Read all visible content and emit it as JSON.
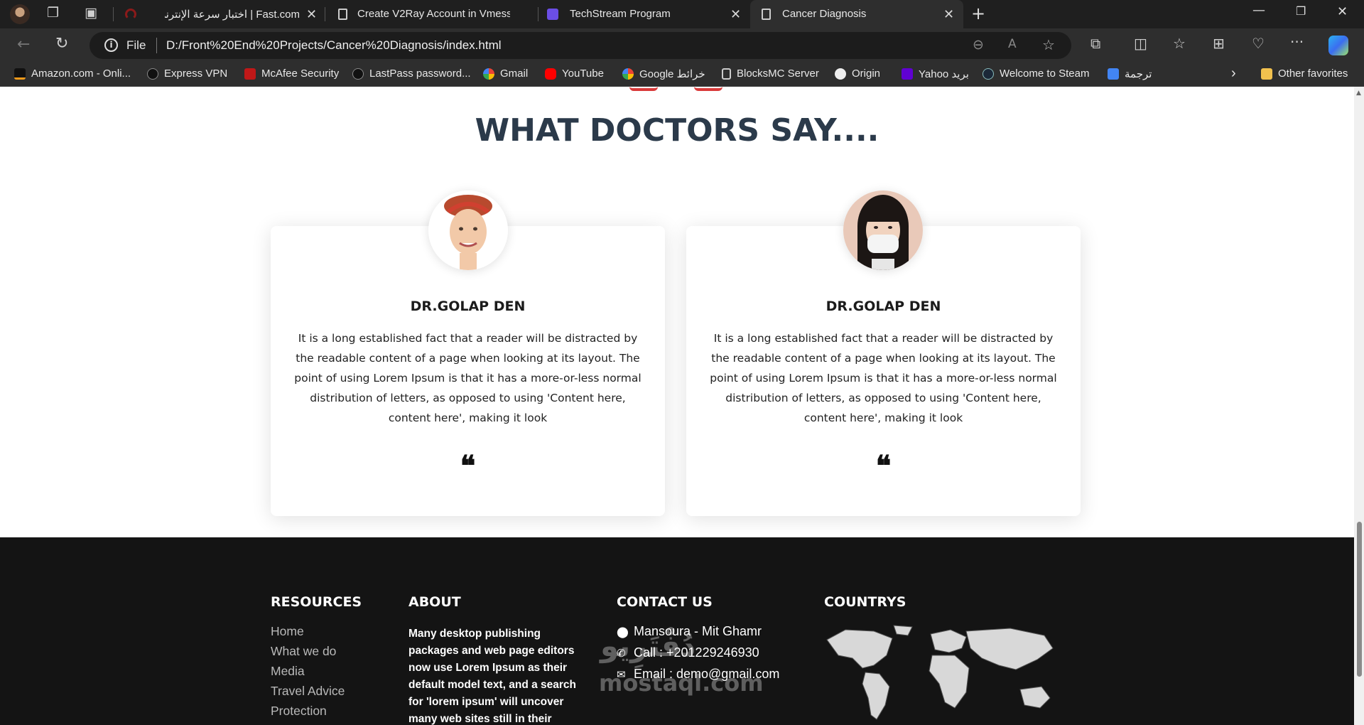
{
  "browser": {
    "tabs": [
      {
        "label": "Fast.com | اختبار سرعة الإنترنت",
        "favicon": "speedometer-icon",
        "active": false
      },
      {
        "label": "Create V2Ray Account in Vmess",
        "favicon": "page-icon",
        "active": false
      },
      {
        "label": "TechStream Program",
        "favicon": "list-icon",
        "active": false
      },
      {
        "label": "Cancer Diagnosis",
        "favicon": "page-icon",
        "active": true
      }
    ],
    "address": {
      "scheme_label": "File",
      "url": "D:/Front%20End%20Projects/Cancer%20Diagnosis/index.html"
    },
    "bookmarks": [
      {
        "label": "Amazon.com - Onli...",
        "icon": "amazon-icon"
      },
      {
        "label": "Express VPN",
        "icon": "hp-icon"
      },
      {
        "label": "McAfee Security",
        "icon": "mcafee-icon"
      },
      {
        "label": "LastPass password...",
        "icon": "hp-icon"
      },
      {
        "label": "Gmail",
        "icon": "google-icon"
      },
      {
        "label": "YouTube",
        "icon": "youtube-icon"
      },
      {
        "label": "Google خرائط",
        "icon": "google-icon"
      },
      {
        "label": "BlocksMC Server",
        "icon": "page-icon"
      },
      {
        "label": "Origin",
        "icon": "ea-icon"
      },
      {
        "label": "Yahoo بريد",
        "icon": "yahoo-icon"
      },
      {
        "label": "Welcome to Steam",
        "icon": "steam-icon"
      },
      {
        "label": "ترجمة",
        "icon": "translate-icon"
      }
    ],
    "other_favorites": "Other favorites"
  },
  "page": {
    "heading": "WHAT DOCTORS SAY....",
    "doctors": [
      {
        "name": "DR.GOLAP DEN",
        "text": "It is a long established fact that a reader will be distracted by the readable content of a page when looking at its layout. The point of using Lorem Ipsum is that it has a more-or-less normal distribution of letters, as opposed to using 'Content here, content here', making it look",
        "quote_glyph": "❝"
      },
      {
        "name": "DR.GOLAP DEN",
        "text": "It is a long established fact that a reader will be distracted by the readable content of a page when looking at its layout. The point of using Lorem Ipsum is that it has a more-or-less normal distribution of letters, as opposed to using 'Content here, content here', making it look",
        "quote_glyph": "❝"
      }
    ],
    "footer": {
      "resources": {
        "title": "RESOURCES",
        "links": [
          "Home",
          "What we do",
          "Media",
          "Travel Advice",
          "Protection"
        ]
      },
      "about": {
        "title": "ABOUT",
        "text": "Many desktop publishing packages and web page editors now use Lorem Ipsum as their default model text, and a search for 'lorem ipsum' will uncover many web sites still in their"
      },
      "contact": {
        "title": "CONTACT US",
        "address": "Mansoura - Mit Ghamr",
        "phone": "Call : +201229246930",
        "email": "Email : demo@gmail.com"
      },
      "countries": {
        "title": "COUNTRYS"
      },
      "watermark": {
        "line1": "دُفْتَرِيو",
        "line2": "mostaql.com"
      }
    }
  },
  "colors": {
    "heading": "#2b3a4a",
    "footer_bg": "#141414",
    "accent_red": "#d93a3a"
  }
}
